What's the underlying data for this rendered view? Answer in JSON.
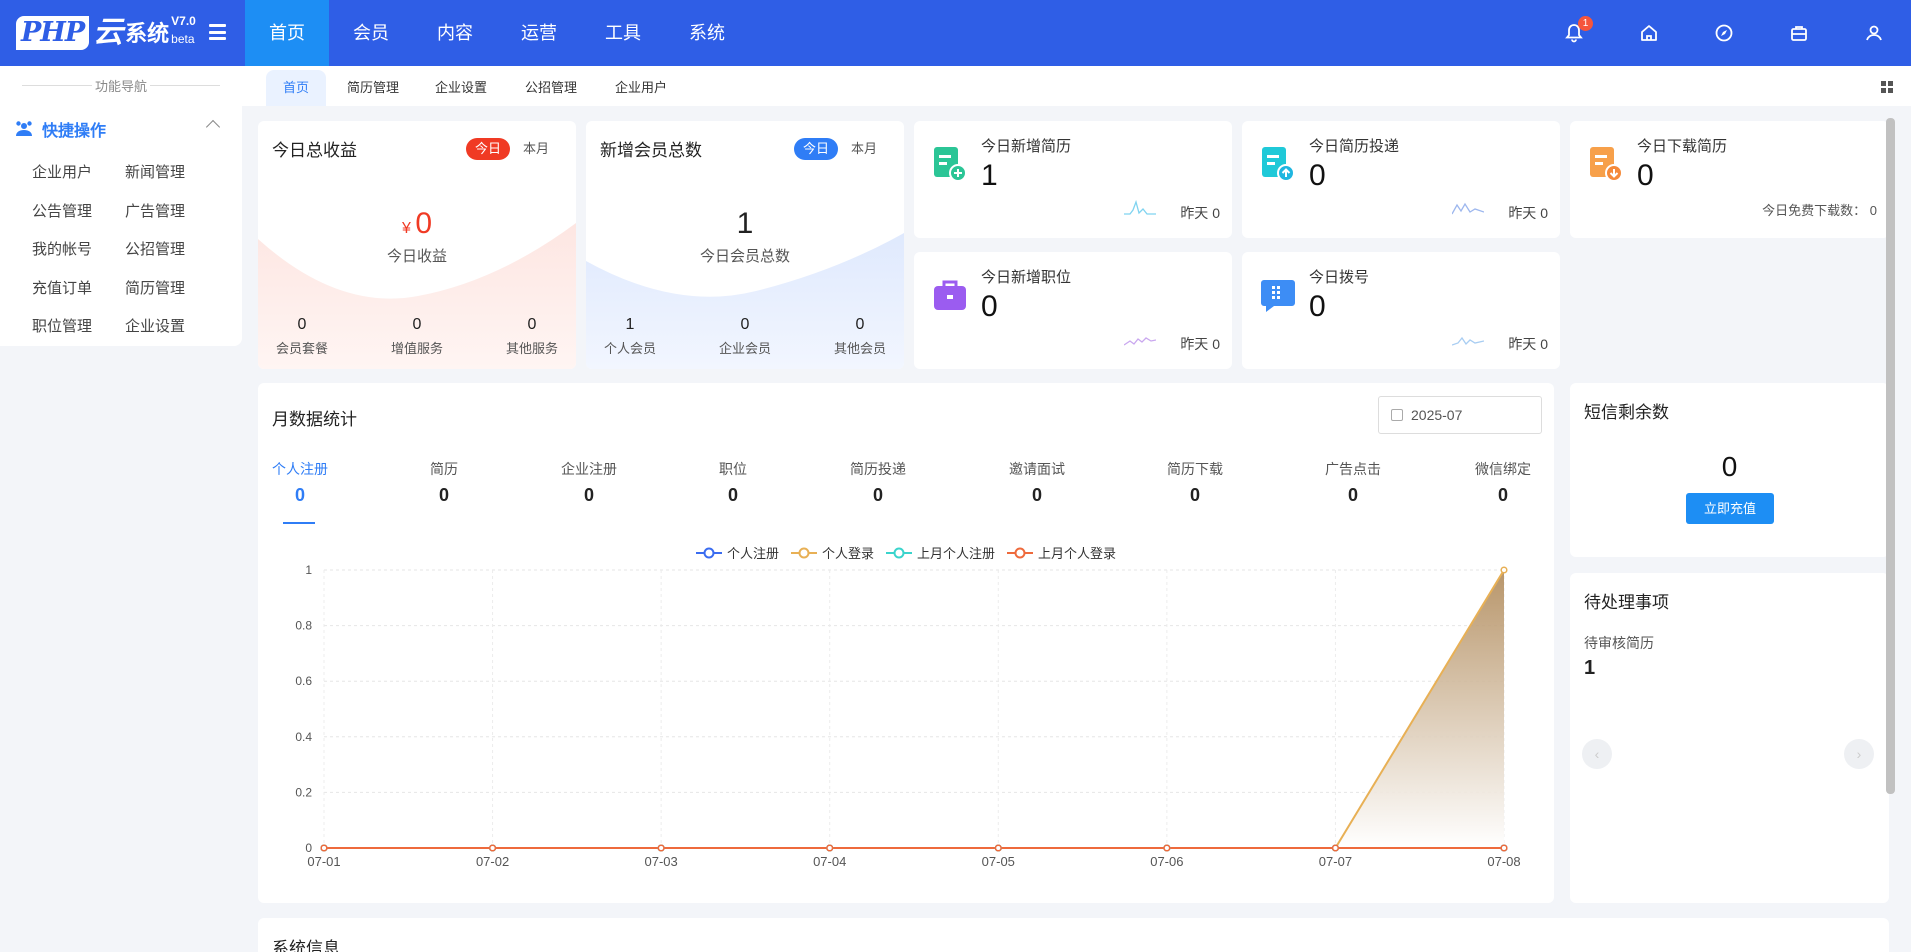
{
  "app": {
    "logo_php": "PHP",
    "logo_yun": "云",
    "logo_xt": "系统",
    "logo_version": "V7.0",
    "logo_beta": "beta"
  },
  "nav": {
    "items": [
      "首页",
      "会员",
      "内容",
      "运营",
      "工具",
      "系统"
    ],
    "active_index": 0,
    "notification_count": "1",
    "icons": [
      "bell-icon",
      "home-icon",
      "compass-icon",
      "briefcase-icon",
      "user-icon"
    ]
  },
  "sidebar": {
    "title": "功能导航",
    "quick_label": "快捷操作",
    "items": [
      "企业用户",
      "新闻管理",
      "公告管理",
      "广告管理",
      "我的帐号",
      "公招管理",
      "充值订单",
      "简历管理",
      "职位管理",
      "企业设置"
    ]
  },
  "tabs": [
    "首页",
    "简历管理",
    "企业设置",
    "公招管理",
    "企业用户"
  ],
  "income": {
    "title": "今日总收益",
    "pill_today": "今日",
    "pill_month": "本月",
    "currency": "¥",
    "value": "0",
    "label": "今日收益",
    "stats": [
      {
        "value": "0",
        "label": "会员套餐"
      },
      {
        "value": "0",
        "label": "增值服务"
      },
      {
        "value": "0",
        "label": "其他服务"
      }
    ]
  },
  "members": {
    "title": "新增会员总数",
    "pill_today": "今日",
    "pill_month": "本月",
    "value": "1",
    "label": "今日会员总数",
    "stats": [
      {
        "value": "1",
        "label": "个人会员"
      },
      {
        "value": "0",
        "label": "企业会员"
      },
      {
        "value": "0",
        "label": "其他会员"
      }
    ]
  },
  "mini_cards": {
    "new_resume": {
      "title": "今日新增简历",
      "value": "1",
      "yesterday": "昨天 0"
    },
    "resume_delivery": {
      "title": "今日简历投递",
      "value": "0",
      "yesterday": "昨天 0"
    },
    "resume_download": {
      "title": "今日下载简历",
      "value": "0",
      "free_label": "今日免费下载数：",
      "free_value": "0"
    },
    "new_job": {
      "title": "今日新增职位",
      "value": "0",
      "yesterday": "昨天 0"
    },
    "dial": {
      "title": "今日拨号",
      "value": "0",
      "yesterday": "昨天 0"
    }
  },
  "month_stats": {
    "title": "月数据统计",
    "date": "2025-07",
    "tabs": [
      {
        "label": "个人注册",
        "value": "0"
      },
      {
        "label": "简历",
        "value": "0"
      },
      {
        "label": "企业注册",
        "value": "0"
      },
      {
        "label": "职位",
        "value": "0"
      },
      {
        "label": "简历投递",
        "value": "0"
      },
      {
        "label": "邀请面试",
        "value": "0"
      },
      {
        "label": "简历下载",
        "value": "0"
      },
      {
        "label": "广告点击",
        "value": "0"
      },
      {
        "label": "微信绑定",
        "value": "0"
      }
    ],
    "active_tab": 0
  },
  "chart_data": {
    "type": "line",
    "x": [
      "07-01",
      "07-02",
      "07-03",
      "07-04",
      "07-05",
      "07-06",
      "07-07",
      "07-08"
    ],
    "ylim": [
      0,
      1
    ],
    "yticks": [
      "0",
      "0.2",
      "0.4",
      "0.6",
      "0.8",
      "1"
    ],
    "grid": true,
    "legend_position": "top-center",
    "series": [
      {
        "name": "个人注册",
        "color": "#3a6cf0",
        "values": [
          0,
          0,
          0,
          0,
          0,
          0,
          0,
          0
        ]
      },
      {
        "name": "个人登录",
        "color": "#e8b055",
        "values": [
          0,
          0,
          0,
          0,
          0,
          0,
          0,
          1
        ],
        "area": true
      },
      {
        "name": "上月个人注册",
        "color": "#3ad4cc",
        "values": [
          0,
          0,
          0,
          0,
          0,
          0,
          0,
          0
        ]
      },
      {
        "name": "上月个人登录",
        "color": "#ee6a3c",
        "values": [
          0,
          0,
          0,
          0,
          0,
          0,
          0,
          0
        ]
      }
    ]
  },
  "sms": {
    "title": "短信剩余数",
    "value": "0",
    "button": "立即充值"
  },
  "pending": {
    "title": "待处理事项",
    "item_label": "待审核简历",
    "item_value": "1",
    "prev": "‹",
    "next": "›"
  },
  "bottom": {
    "title": "系统信息"
  }
}
